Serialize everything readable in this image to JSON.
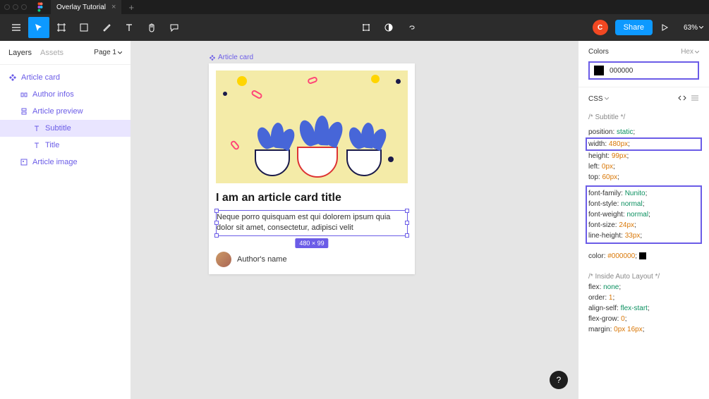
{
  "tabbar": {
    "title": "Overlay Tutorial"
  },
  "toolbar": {
    "avatar_letter": "C",
    "share_label": "Share",
    "zoom": "63%"
  },
  "left_panel": {
    "tab_layers": "Layers",
    "tab_assets": "Assets",
    "page": "Page 1",
    "tree": [
      {
        "name": "Article card",
        "type": "component",
        "indent": 0
      },
      {
        "name": "Author infos",
        "type": "frame",
        "indent": 1
      },
      {
        "name": "Article preview",
        "type": "frame",
        "indent": 1
      },
      {
        "name": "Subtitle",
        "type": "text",
        "indent": 2,
        "selected": true
      },
      {
        "name": "Title",
        "type": "text",
        "indent": 2
      },
      {
        "name": "Article image",
        "type": "image",
        "indent": 1
      }
    ]
  },
  "canvas": {
    "frame_label": "Article card",
    "card": {
      "title": "I am an article card title",
      "subtitle": "Neque porro quisquam est qui dolorem ipsum quia dolor sit amet, consectetur, adipisci velit",
      "author": "Author's name",
      "dim_badge": "480 × 99"
    }
  },
  "right_panel": {
    "colors_label": "Colors",
    "hex_label": "Hex",
    "color_value": "000000",
    "css_label": "CSS",
    "code": {
      "comment_1": "/* Subtitle */",
      "l1": {
        "prop": "position",
        "val": "static"
      },
      "l2": {
        "prop": "width",
        "val": "480px"
      },
      "l3": {
        "prop": "height",
        "val": "99px"
      },
      "l4": {
        "prop": "left",
        "val": "0px"
      },
      "l5": {
        "prop": "top",
        "val": "60px"
      },
      "l6": {
        "prop": "font-family",
        "val": "Nunito"
      },
      "l7": {
        "prop": "font-style",
        "val": "normal"
      },
      "l8": {
        "prop": "font-weight",
        "val": "normal"
      },
      "l9": {
        "prop": "font-size",
        "val": "24px"
      },
      "l10": {
        "prop": "line-height",
        "val": "33px"
      },
      "l11": {
        "prop": "color",
        "val": "#000000"
      },
      "comment_2": "/* Inside Auto Layout */",
      "l12": {
        "prop": "flex",
        "val": "none"
      },
      "l13": {
        "prop": "order",
        "val": "1"
      },
      "l14": {
        "prop": "align-self",
        "val": "flex-start"
      },
      "l15": {
        "prop": "flex-grow",
        "val": "0"
      },
      "l16": {
        "prop": "margin",
        "val": "0px 16px"
      }
    }
  }
}
